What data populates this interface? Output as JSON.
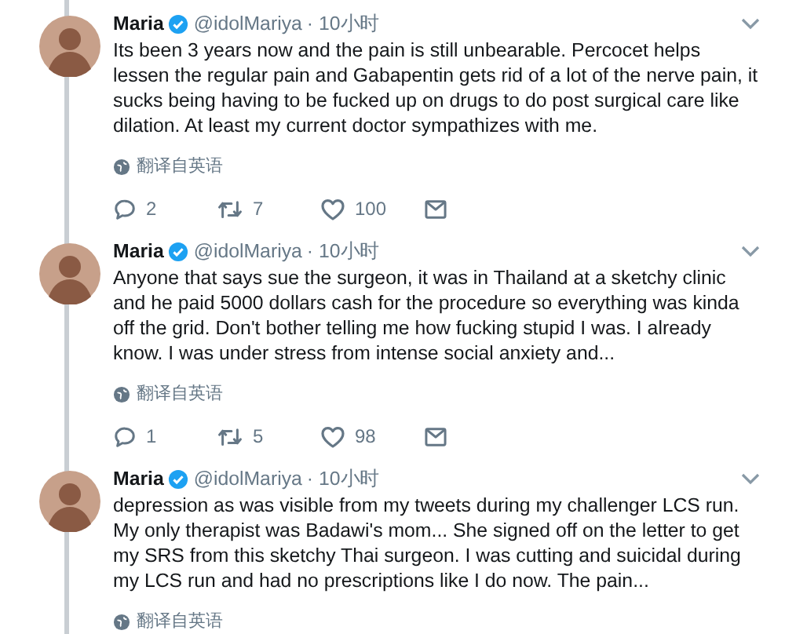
{
  "tweets": [
    {
      "name": "Maria",
      "handle": "@idolMariya",
      "time": "· 10小时",
      "text": "Its been 3 years now and the pain is still unbearable. Percocet helps lessen the regular pain and Gabapentin gets rid of a lot of the nerve pain, it sucks being having to be fucked up on drugs to do post surgical care like dilation. At least my current doctor sympathizes with me.",
      "translate": "翻译自英语",
      "replies": "2",
      "retweets": "7",
      "likes": "100"
    },
    {
      "name": "Maria",
      "handle": "@idolMariya",
      "time": "· 10小时",
      "text": "Anyone that says sue the surgeon, it was in Thailand at a sketchy clinic and he paid 5000 dollars cash for the procedure so everything was kinda off the grid. Don't bother telling me how fucking stupid I was. I already know. I was under stress from intense social anxiety and...",
      "translate": "翻译自英语",
      "replies": "1",
      "retweets": "5",
      "likes": "98"
    },
    {
      "name": "Maria",
      "handle": "@idolMariya",
      "time": "· 10小时",
      "text": "depression as was visible from my tweets during my challenger LCS run. My only therapist was Badawi's mom... She signed off on the letter to get my SRS from this sketchy Thai surgeon. I was cutting and suicidal during my LCS run and had no prescriptions like I do now. The pain...",
      "translate": "翻译自英语"
    }
  ]
}
